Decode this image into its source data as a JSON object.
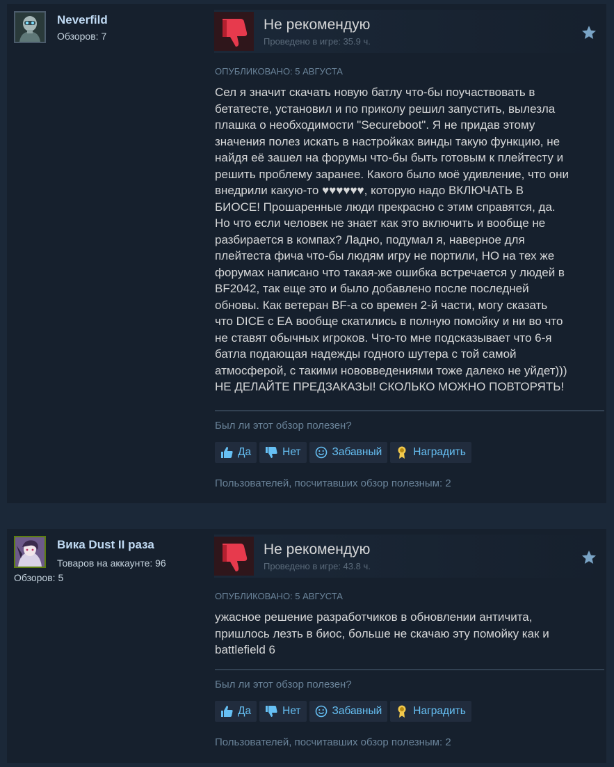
{
  "colors": {
    "page_background": "#1b2838",
    "card_background": "#16202d",
    "author_name": "#c1dbf4",
    "thumbs_down_red": "#e73a4d",
    "button_text": "#66c0f4",
    "award_gold": "#f2c94c"
  },
  "reviews": [
    {
      "author": {
        "name": "Neverfild",
        "line1": "Обзоров: 7",
        "line2": "",
        "avatar_icon": "robot-avatar"
      },
      "verdict_icon": "thumbs-down-icon",
      "verdict": "Не рекомендую",
      "hours": "Проведено в игре: 35.9 ч.",
      "posted": "ОПУБЛИКОВАНО: 5 АВГУСТА",
      "body": "Сел я значит скачать новую батлу что-бы поучаствовать в\nбетатесте, установил и по приколу решил запустить, вылезла\nплашка о необходимости \"Secureboot\". Я не придав этому\nзначения полез искать в настройках винды такую функцию, не\nнайдя её зашел на форумы что-бы быть готовым к плейтесту и\nрешить проблему заранее. Какого было моё удивление, что они\nвнедрили какую-то ♥♥♥♥♥♥, которую надо ВКЛЮЧАТЬ В\nБИОСЕ! Прошаренные люди прекрасно с этим справятся, да.\nНо что если человек не знает как это включить и вообще не\nразбирается в компах? Ладно, подумал я, наверное для\nплейтеста фича что-бы людям игру не портили, НО на тех же\nфорумах написано что такая-же ошибка встречается у людей в\nBF2042, так еще это и было добавлено после последней\nобновы. Как ветеран BF-а со времен 2-й части, могу сказать\nчто DICE с ЕА вообще скатились в полную помойку и ни во что\nне ставят обычных игроков. Что-то мне подсказывает что 6-я\nбатла подающая надежды годного шутера с той самой\nатмосферой, с такими нововведениями тоже далеко не уйдет)))\nНЕ ДЕЛАЙТЕ ПРЕДЗАКАЗЫ! СКОЛЬКО МОЖНО ПОВТОРЯТЬ!",
      "helpful_question": "Был ли этот обзор полезен?",
      "buttons": {
        "yes": "Да",
        "no": "Нет",
        "funny": "Забавный",
        "award": "Наградить"
      },
      "helpful_count": "Пользователей, посчитавших обзор полезным: 2"
    },
    {
      "author": {
        "name": "Вика Dust II раза",
        "line1": "Товаров на аккаунте: 96",
        "line2": "Обзоров: 5",
        "avatar_icon": "anime-character-avatar"
      },
      "verdict_icon": "thumbs-down-icon",
      "verdict": "Не рекомендую",
      "hours": "Проведено в игре: 43.8 ч.",
      "posted": "ОПУБЛИКОВАНО: 5 АВГУСТА",
      "body": "ужасное решение разработчиков в обновлении античита,\nпришлось лезть в биос, больше не скачаю эту помойку как и\nbattlefield 6",
      "helpful_question": "Был ли этот обзор полезен?",
      "buttons": {
        "yes": "Да",
        "no": "Нет",
        "funny": "Забавный",
        "award": "Наградить"
      },
      "helpful_count": "Пользователей, посчитавших обзор полезным: 2"
    }
  ]
}
